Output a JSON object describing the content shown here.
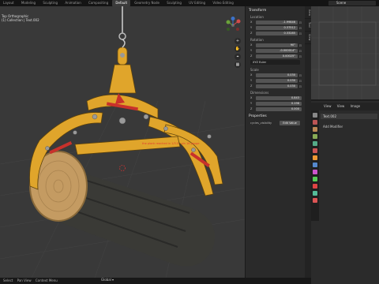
{
  "topbar": {
    "workspaces": [
      "Layout",
      "Modeling",
      "Sculpting",
      "Animation",
      "Compositing",
      "Default",
      "Geometry Node",
      "Sculpting",
      "UV Editing",
      "Video Editing"
    ],
    "active_workspace": "Default",
    "scene": "Scene"
  },
  "viewport": {
    "info_line1": "Top Orthographic",
    "info_line2": "(1) Collection | Text.002",
    "tools": [
      "+",
      "✋",
      "⌖",
      "▦"
    ],
    "annotation_text": "the plank reached in 1/3.5  ·  pin 16 gauge"
  },
  "npanel": {
    "transform_title": "Transform",
    "location_label": "Location",
    "location": [
      {
        "axis": "X",
        "value": "-1.99846"
      },
      {
        "axis": "Y",
        "value": "0.37512"
      },
      {
        "axis": "Z",
        "value": "0.33285"
      }
    ],
    "rotation_label": "Rotation",
    "rotation": [
      {
        "axis": "X",
        "value": "90°"
      },
      {
        "axis": "Y",
        "value": "-0.000014°"
      },
      {
        "axis": "Z",
        "value": "0.00025°"
      }
    ],
    "rotation_mode": "XYZ Euler",
    "scale_label": "Scale",
    "scale": [
      {
        "axis": "X",
        "value": "0.030"
      },
      {
        "axis": "Y",
        "value": "0.030"
      },
      {
        "axis": "Z",
        "value": "0.030"
      }
    ],
    "dimensions_label": "Dimensions",
    "dimensions": [
      {
        "axis": "X",
        "value": "0.843"
      },
      {
        "axis": "Y",
        "value": "0.198"
      },
      {
        "axis": "Z",
        "value": "0.000"
      }
    ],
    "properties_title": "Properties",
    "cycles_label": "cycles_visibility",
    "cycles_button": "Edit Value",
    "side_tabs": [
      "Item",
      "Tool",
      "View"
    ]
  },
  "right": {
    "toolbar": [
      "View",
      "View",
      "Image"
    ],
    "object_name": "Text.002",
    "add_modifier": "Add Modifier"
  },
  "statusbar": {
    "items": [
      "Select",
      "Pan View",
      "Context Menu"
    ],
    "view_menu": "Global"
  },
  "colors": {
    "viewport_bg": "#393939",
    "crane_yellow": "#e0a52b",
    "log_wood": "#c49b62",
    "accent_red": "#c8312b"
  }
}
